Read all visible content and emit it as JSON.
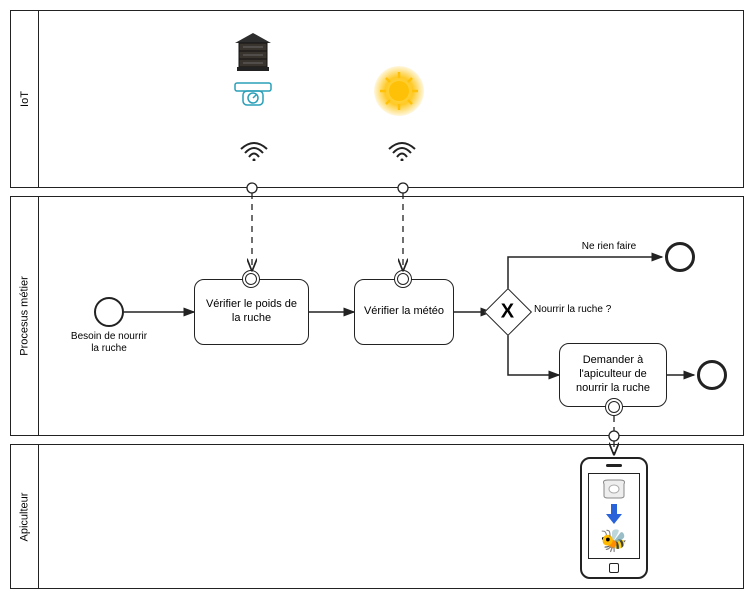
{
  "lanes": {
    "iot": "IoT",
    "process": "Procesus métier",
    "apiculteur": "Apiculteur"
  },
  "iot": {
    "hive_sensor": "hive-scale-sensor",
    "weather_sensor": "weather-sensor"
  },
  "process": {
    "start_label": "Besoin de nourrir la ruche",
    "task_weight": "Vérifier le poids de la ruche",
    "task_weather": "Vérifier la météo",
    "gateway_question": "Nourrir la ruche ?",
    "path_no": "Ne rien faire",
    "task_request": "Demander à l'apiculteur de nourrir la ruche"
  },
  "apiculteur": {
    "device": "phone-notification"
  }
}
